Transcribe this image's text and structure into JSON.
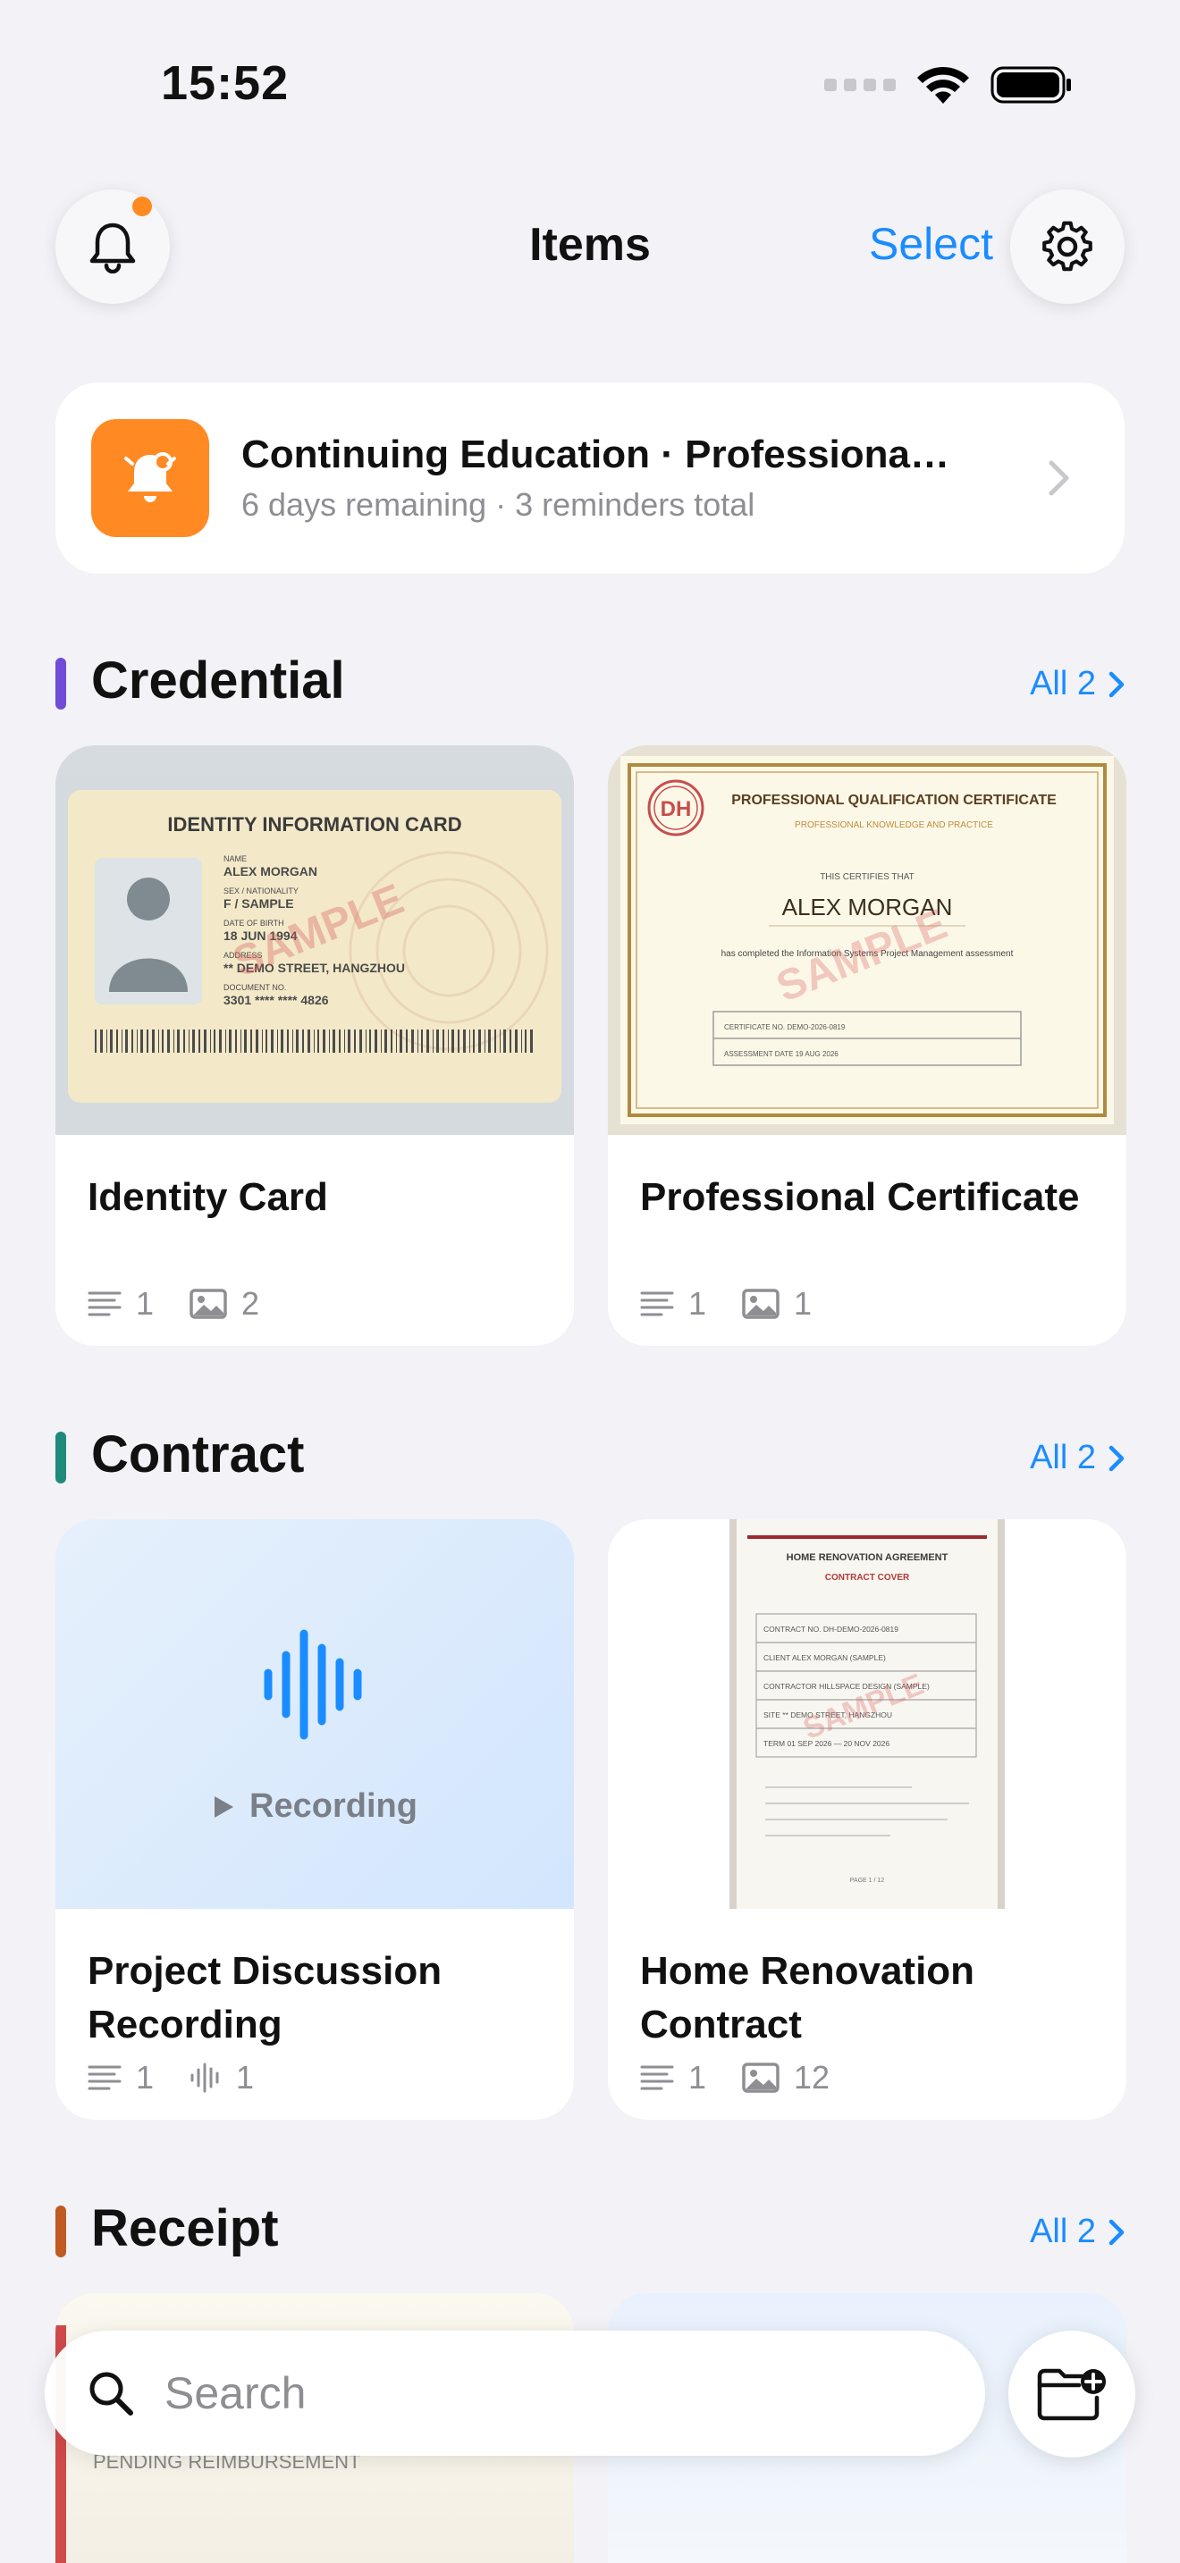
{
  "status": {
    "time": "15:52"
  },
  "header": {
    "title": "Items",
    "select_label": "Select"
  },
  "reminder": {
    "title": "Continuing Education · Professional Qualification",
    "subtitle": "6 days remaining · 3 reminders total"
  },
  "sections": [
    {
      "title": "Credential",
      "all_label": "All 2",
      "color": "#6f4bd8",
      "items": [
        {
          "title": "Identity Card",
          "notes": "1",
          "images": "2",
          "thumb": {
            "heading": "IDENTITY INFORMATION CARD",
            "name_label": "NAME",
            "name": "ALEX MORGAN",
            "sex_label": "SEX / NATIONALITY",
            "sex": "F / SAMPLE",
            "dob_label": "DATE OF BIRTH",
            "dob": "18 JUN 1994",
            "addr_label": "ADDRESS",
            "addr": "** DEMO STREET, HANGZHOU",
            "doc_label": "DOCUMENT NO.",
            "doc": "3301 **** **** 4826",
            "watermark": "SAMPLE"
          }
        },
        {
          "title": "Professional Certificate",
          "notes": "1",
          "images": "1",
          "thumb": {
            "seal": "DH",
            "heading": "PROFESSIONAL QUALIFICATION CERTIFICATE",
            "subheading": "PROFESSIONAL KNOWLEDGE AND PRACTICE",
            "certifies": "THIS CERTIFIES THAT",
            "name": "ALEX MORGAN",
            "body": "has completed the Information Systems Project Management assessment",
            "cert_no": "CERTIFICATE NO.  DEMO-2026-0819",
            "date": "ASSESSMENT DATE  19 AUG 2026",
            "watermark": "SAMPLE"
          }
        }
      ]
    },
    {
      "title": "Contract",
      "all_label": "All 2",
      "color": "#1f8a7a",
      "items": [
        {
          "title": "Project Discussion Recording",
          "notes": "1",
          "audio": "1",
          "thumb": {
            "label": "Recording"
          }
        },
        {
          "title": "Home Renovation Contract",
          "notes": "1",
          "images": "12",
          "thumb": {
            "heading": "HOME RENOVATION AGREEMENT",
            "subheading": "CONTRACT COVER",
            "rows": [
              "CONTRACT NO.  DH-DEMO-2026-0819",
              "CLIENT  ALEX MORGAN (SAMPLE)",
              "CONTRACTOR  HILLSPACE DESIGN (SAMPLE)",
              "SITE  ** DEMO STREET, HANGZHOU",
              "TERM  01 SEP 2026 — 20 NOV 2026"
            ],
            "page": "PAGE 1 / 12",
            "watermark": "SAMPLE"
          }
        }
      ]
    },
    {
      "title": "Receipt",
      "all_label": "All 2",
      "color": "#c05a22",
      "items": [
        {
          "thumb": {
            "label": "PENDING REIMBURSEMENT"
          }
        }
      ]
    }
  ],
  "search": {
    "placeholder": "Search"
  },
  "colors": {
    "accent": "#1a8cff",
    "reminder": "#ff8a24",
    "badge": "#ff8a1f"
  }
}
